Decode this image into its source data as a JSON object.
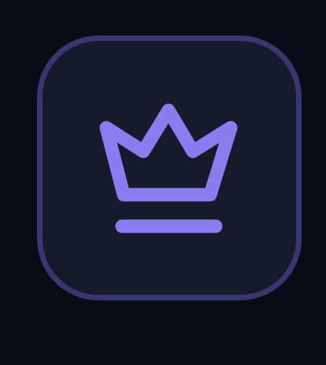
{
  "app_icon": {
    "icon": "crown-icon",
    "colors": {
      "background": "#090c14",
      "tile_fill": "#171a2c",
      "tile_border": "#3a3670",
      "icon_stroke": "#8b7cf0"
    }
  }
}
